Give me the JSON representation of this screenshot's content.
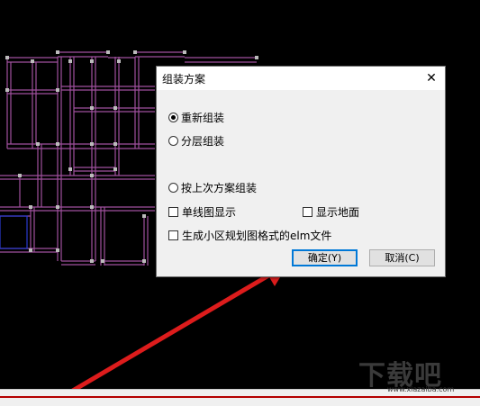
{
  "dialog": {
    "title": "组装方案",
    "close_glyph": "✕",
    "options": [
      {
        "label": "重新组装",
        "selected": true
      },
      {
        "label": "分层组装",
        "selected": false
      },
      {
        "label": "按上次方案组装",
        "selected": false
      }
    ],
    "checkboxes": [
      {
        "label": "单线图显示",
        "checked": false
      },
      {
        "label": "显示地面",
        "checked": false
      },
      {
        "label": "生成小区规划图格式的elm文件",
        "checked": false
      }
    ],
    "ok_label": "确定(Y)",
    "cancel_label": "取消(C)"
  },
  "watermark": {
    "text": "下载吧",
    "sub": "www.xiazaiba.com"
  },
  "colors": {
    "background": "#000000",
    "walls": "#a0509e",
    "arrow": "#dd1c1c",
    "dialog_bg": "#f0f0f0"
  }
}
